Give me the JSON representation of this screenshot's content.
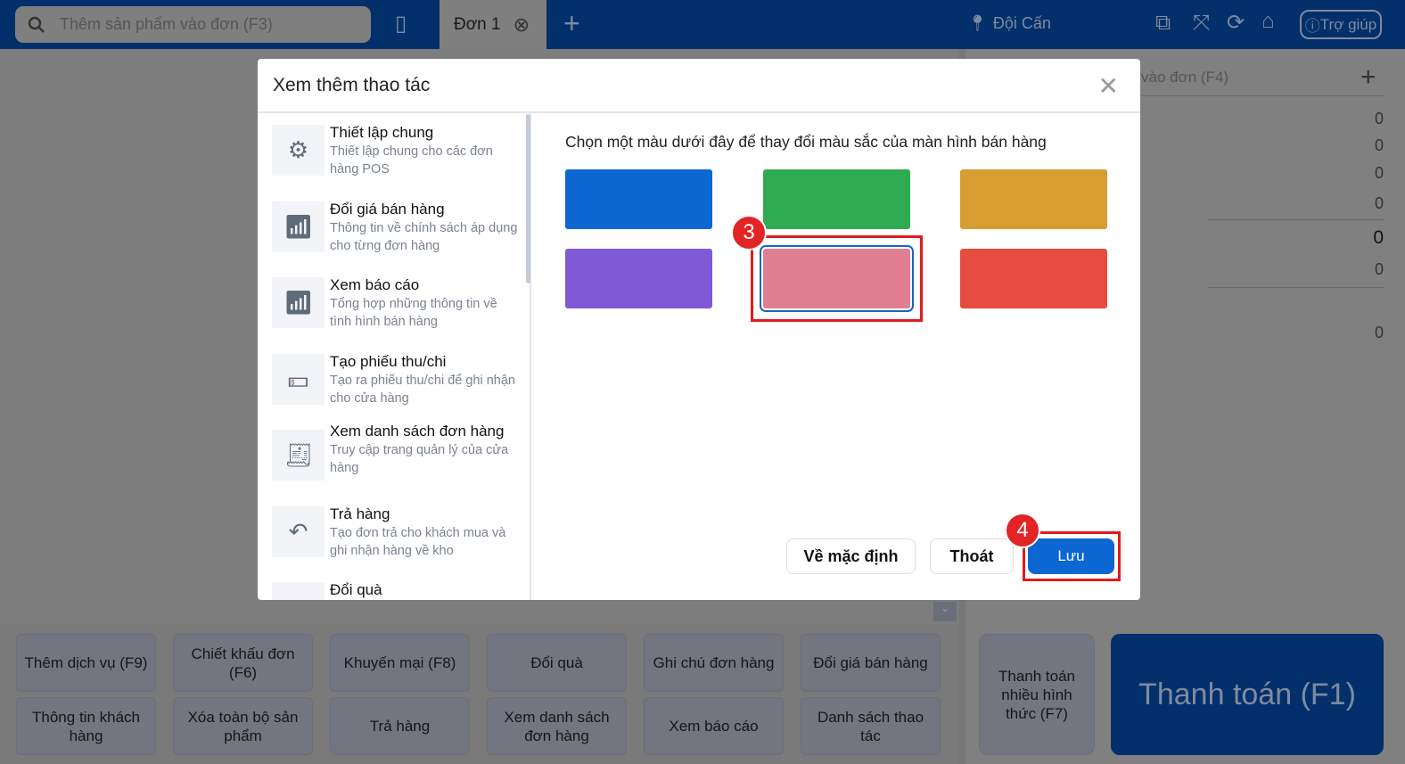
{
  "header": {
    "search_placeholder": "Thêm sản phẩm vào đơn (F3)",
    "tab_label": "Đơn 1",
    "location": "Đội Cấn",
    "help": "Trợ giúp"
  },
  "right_panel": {
    "search_placeholder": "vào đơn (F4)",
    "values": [
      "0",
      "0",
      "0",
      "0",
      "0",
      "0",
      "0"
    ]
  },
  "bottom_buttons": [
    "Thêm dịch vụ (F9)",
    "Chiết khấu đơn (F6)",
    "Khuyến mại (F8)",
    "Đổi quà",
    "Ghi chú đơn hàng",
    "Đổi giá bán hàng",
    "Thông tin khách hàng",
    "Xóa toàn bộ sản phẩm",
    "Trả hàng",
    "Xem danh sách đơn hàng",
    "Xem báo cáo",
    "Danh sách thao tác"
  ],
  "pay_multi": "Thanh toán nhiều hình thức (F7)",
  "pay": "Thanh toán (F1)",
  "modal": {
    "title": "Xem thêm thao tác",
    "items": [
      {
        "title": "Thiết lập chung",
        "desc": "Thiết lập chung cho các đơn hàng POS",
        "icon": "gears-icon"
      },
      {
        "title": "Đổi giá bán hàng",
        "desc": "Thông tin về chính sách áp dụng cho từng đơn hàng",
        "icon": "chart-icon"
      },
      {
        "title": "Xem báo cáo",
        "desc": "Tổng hợp những thông tin về tình hình bán hàng",
        "icon": "chart-icon"
      },
      {
        "title": "Tạo phiếu thu/chi",
        "desc": "Tạo ra phiếu thu/chi để ghi nhận cho cửa hàng",
        "icon": "money-icon"
      },
      {
        "title": "Xem danh sách đơn hàng",
        "desc": "Truy cập trang quản lý của cửa hàng",
        "icon": "invoice-icon"
      },
      {
        "title": "Trả hàng",
        "desc": "Tạo đơn trả cho khách mua và ghi nhận hàng về kho",
        "icon": "return-icon"
      },
      {
        "title": "Đổi quà",
        "desc": "",
        "icon": "gift-icon"
      }
    ],
    "prompt": "Chọn một màu dưới đây để thay đổi màu sắc của màn hình bán hàng",
    "colors": [
      "#0d67d3",
      "#2eaa50",
      "#d69d30",
      "#7e5ad6",
      "#e07f92",
      "#e64c40"
    ],
    "selected_color_index": 4,
    "buttons": {
      "default": "Về mặc định",
      "exit": "Thoát",
      "save": "Lưu"
    },
    "annotations": [
      "3",
      "4"
    ]
  }
}
